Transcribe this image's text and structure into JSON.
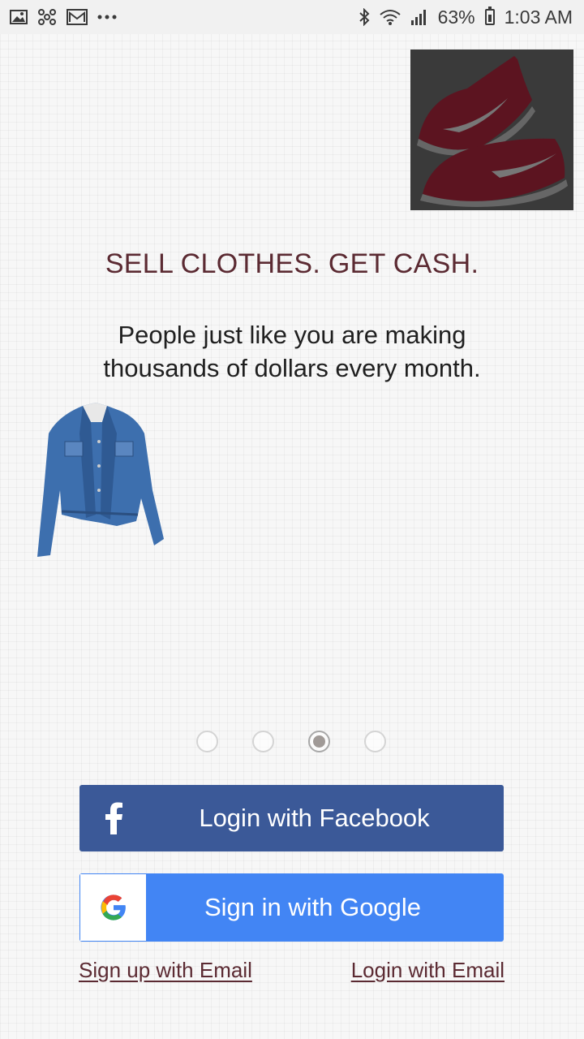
{
  "status_bar": {
    "left_icons": [
      "gallery-icon",
      "fan-icon",
      "mail-icon",
      "more-dots-icon"
    ],
    "battery_percent": "63%",
    "time": "1:03 AM"
  },
  "hero": {
    "headline": "SELL CLOTHES. GET CASH.",
    "subhead_line1": "People just like you are making",
    "subhead_line2": "thousands of dollars every month."
  },
  "pager": {
    "count": 4,
    "active_index": 2
  },
  "buttons": {
    "facebook_label": "Login with Facebook",
    "google_label": "Sign in with Google"
  },
  "links": {
    "signup_email": "Sign up with Email",
    "login_email": "Login with Email"
  },
  "colors": {
    "headline": "#5b2a32",
    "facebook": "#3b5998",
    "google": "#4285f4"
  }
}
